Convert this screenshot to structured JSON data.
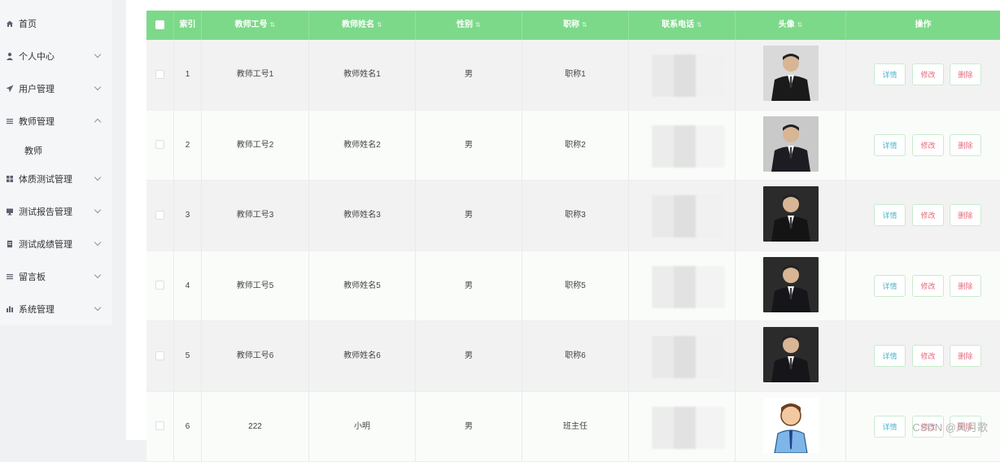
{
  "sidebar": {
    "items": [
      {
        "label": "首页",
        "icon": "home-icon",
        "has_chevron": false
      },
      {
        "label": "个人中心",
        "icon": "user-icon",
        "has_chevron": true
      },
      {
        "label": "用户管理",
        "icon": "send-icon",
        "has_chevron": true
      },
      {
        "label": "教师管理",
        "icon": "list-icon",
        "has_chevron": true
      },
      {
        "label": "体质测试管理",
        "icon": "grid-icon",
        "has_chevron": true
      },
      {
        "label": "测试报告管理",
        "icon": "monitor-icon",
        "has_chevron": true
      },
      {
        "label": "测试成绩管理",
        "icon": "document-icon",
        "has_chevron": true
      },
      {
        "label": "留言板",
        "icon": "list-icon",
        "has_chevron": true
      },
      {
        "label": "系统管理",
        "icon": "chart-icon",
        "has_chevron": true
      }
    ],
    "sub_item": {
      "label": "教师"
    }
  },
  "table": {
    "headers": [
      "索引",
      "教师工号",
      "教师姓名",
      "性别",
      "职称",
      "联系电话",
      "头像",
      "操作"
    ],
    "rows": [
      {
        "index": "1",
        "id": "教师工号1",
        "name": "教师姓名1",
        "gender": "男",
        "title": "职称1"
      },
      {
        "index": "2",
        "id": "教师工号2",
        "name": "教师姓名2",
        "gender": "男",
        "title": "职称2"
      },
      {
        "index": "3",
        "id": "教师工号3",
        "name": "教师姓名3",
        "gender": "男",
        "title": "职称3"
      },
      {
        "index": "4",
        "id": "教师工号5",
        "name": "教师姓名5",
        "gender": "男",
        "title": "职称5"
      },
      {
        "index": "5",
        "id": "教师工号6",
        "name": "教师姓名6",
        "gender": "男",
        "title": "职称6"
      },
      {
        "index": "6",
        "id": "222",
        "name": "小明",
        "gender": "男",
        "title": "班主任"
      }
    ],
    "actions": {
      "detail": "详情",
      "edit": "修改",
      "delete": "删除"
    }
  },
  "colors": {
    "header_green": "#7dd98a",
    "accent_blue": "#4cb5c9",
    "accent_red": "#e66a7a"
  },
  "watermark": "CSDN @风月歌"
}
